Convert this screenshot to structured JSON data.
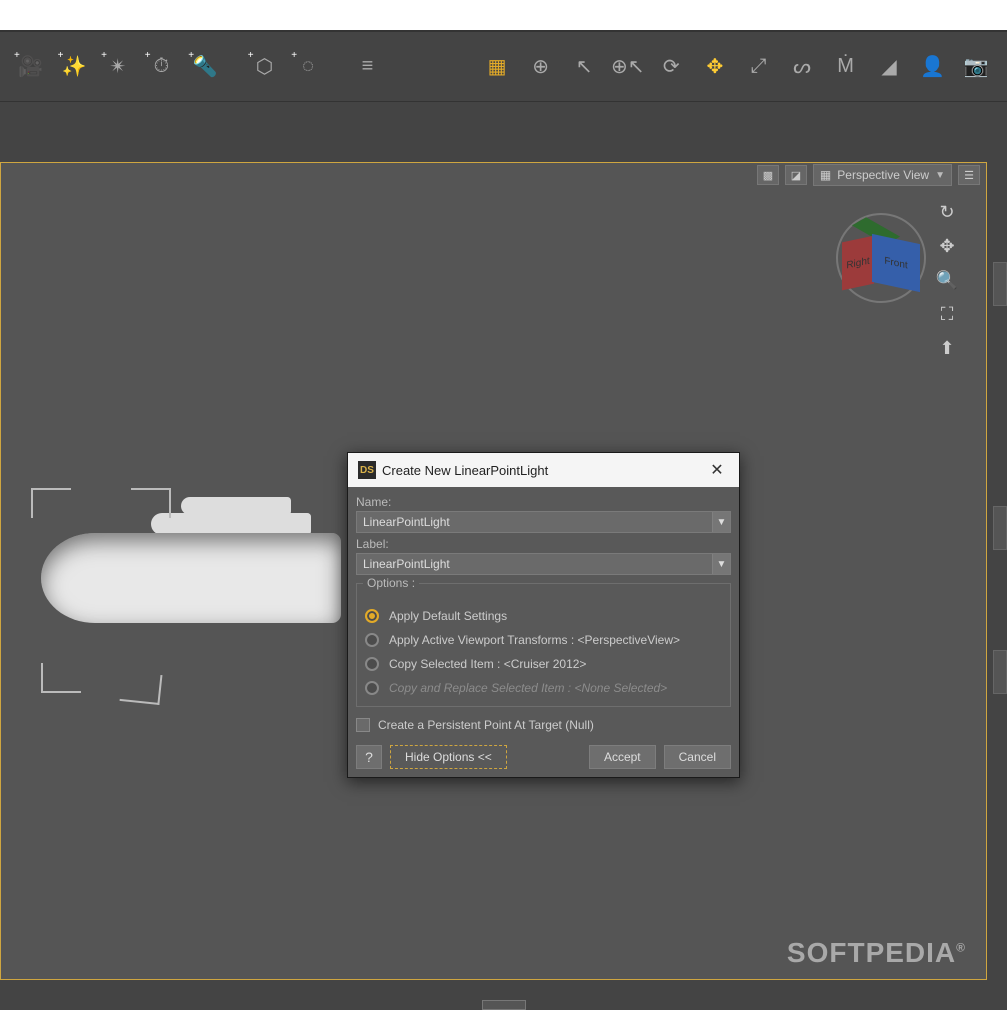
{
  "viewport": {
    "view_label": "Perspective View"
  },
  "viewcube": {
    "right": "Right",
    "front": "Front"
  },
  "dialog": {
    "title": "Create New LinearPointLight",
    "logo": "DS",
    "name_label": "Name:",
    "name_value": "LinearPointLight",
    "label_label": "Label:",
    "label_value": "LinearPointLight",
    "options_title": "Options :",
    "opt1": "Apply Default Settings",
    "opt2": "Apply Active Viewport Transforms : <PerspectiveView>",
    "opt3": "Copy Selected Item : <Cruiser 2012>",
    "opt4": "Copy and Replace Selected Item : <None Selected>",
    "check1": "Create a Persistent Point At Target (Null)",
    "hide_btn": "Hide Options <<",
    "accept_btn": "Accept",
    "cancel_btn": "Cancel"
  },
  "watermark": "SOFTPEDIA"
}
